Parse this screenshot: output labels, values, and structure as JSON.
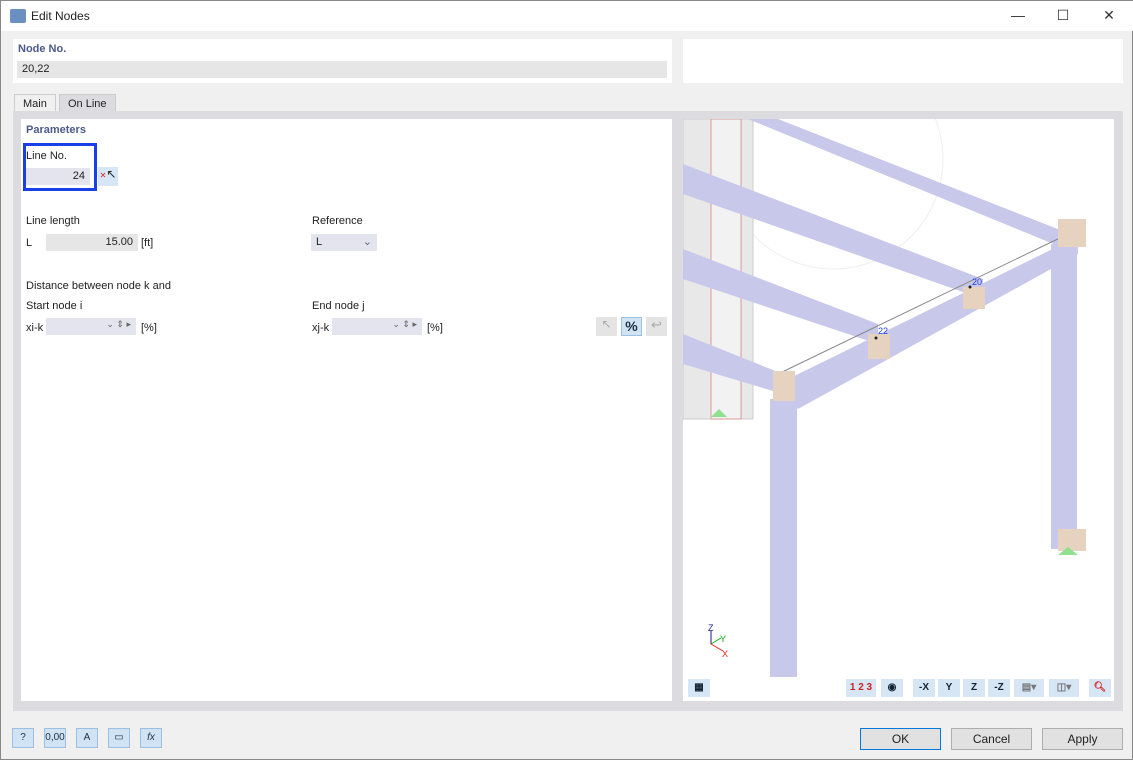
{
  "window": {
    "title": "Edit Nodes",
    "minimize": "—",
    "maximize": "☐",
    "close": "✕"
  },
  "node": {
    "label": "Node No.",
    "value": "20,22"
  },
  "tabs": [
    {
      "label": "Main",
      "active": false
    },
    {
      "label": "On Line",
      "active": true
    }
  ],
  "params": {
    "heading": "Parameters",
    "line_no_label": "Line No.",
    "line_no": "24",
    "line_length_label": "Line length",
    "L_symbol": "L",
    "L_value": "15.00",
    "L_unit": "[ft]",
    "reference_label": "Reference",
    "reference_value": "L",
    "distance_label": "Distance between node k and",
    "start_label": "Start node i",
    "start_symbol": "xi-k",
    "start_unit": "[%]",
    "end_label": "End node j",
    "end_symbol": "xj-k",
    "end_unit": "[%]",
    "percent_button": "%"
  },
  "view": {
    "node_labels": [
      "20",
      "22"
    ],
    "axes": [
      "X",
      "Y",
      "Z"
    ],
    "toolbar": [
      "1 2 3",
      "-X",
      "Y",
      "Z",
      "-Z"
    ]
  },
  "footer": {
    "ok": "OK",
    "cancel": "Cancel",
    "apply": "Apply",
    "units_icon": "0,00"
  },
  "colors": {
    "highlight": "#1a3ee8",
    "beam": "#c8c8ea",
    "support": "#8fe08f"
  }
}
